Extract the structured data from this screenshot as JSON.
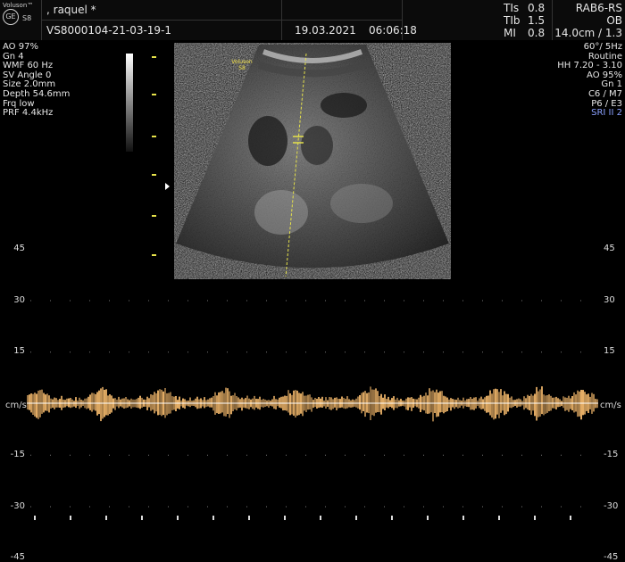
{
  "header": {
    "brand": "Voluson™",
    "model": "S8",
    "logo_text": "GE",
    "patient_name": ", raquel  *",
    "exam_id": "VS8000104-21-03-19-1",
    "date": "19.03.2021",
    "time": "06:06:18",
    "indices": [
      {
        "label": "TIs",
        "value": "0.8"
      },
      {
        "label": "TIb",
        "value": "1.5"
      },
      {
        "label": "MI",
        "value": "0.8"
      }
    ],
    "probe": "RAB6-RS",
    "app": "OB",
    "depth_freq": "14.0cm / 1.3"
  },
  "left_params": [
    "AO 97%",
    "Gn  4",
    "WMF 60 Hz",
    "SV Angle  0",
    "Size  2.0mm",
    "Depth 54.6mm",
    "Frq low",
    "PRF  4.4kHz"
  ],
  "right_params": [
    "60°/  5Hz",
    "Routine",
    "HH  7.20 - 3.10",
    "AO 95%",
    "Gn  1",
    "C6 / M7",
    "P6 / E3",
    "SRI II 2"
  ],
  "image_label": {
    "line1": "Voluson",
    "line2": "S8"
  },
  "doppler": {
    "unit": "cm/s",
    "scale": [
      {
        "label": "45",
        "value": 45
      },
      {
        "label": "30",
        "value": 30
      },
      {
        "label": "15",
        "value": 15
      },
      {
        "label": "-15",
        "value": -15
      },
      {
        "label": "-30",
        "value": -30
      },
      {
        "label": "-45",
        "value": -45
      }
    ]
  },
  "colors": {
    "doppler": "#f0b66a",
    "cursor": "#e6e24a",
    "srI": "#8aa0ff",
    "label": "#f2e14a"
  }
}
